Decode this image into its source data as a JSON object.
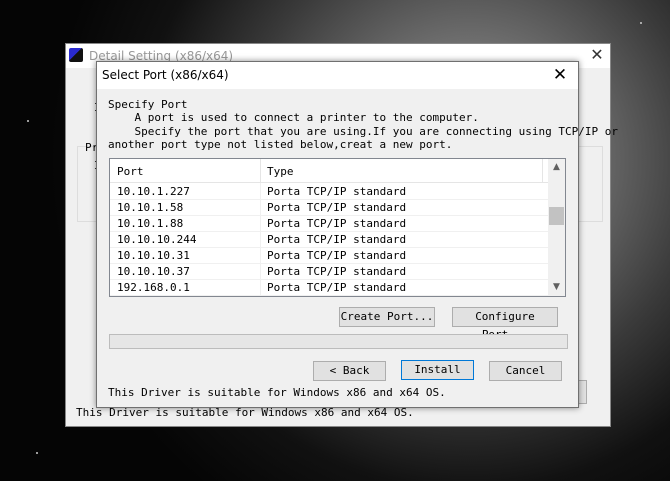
{
  "back_window": {
    "title": "Detail Setting (x86/x64)",
    "close_glyph": "✕",
    "footer_text": "This Driver is suitable for Windows x86 and x64 OS.",
    "frag_1": "I",
    "frag_2": "Pr",
    "frag_3": "I"
  },
  "dialog": {
    "title": "Select Port (x86/x64)",
    "close_glyph": "✕",
    "heading": "Specify Port",
    "desc_line1": "    A port is used to connect a printer to the computer.",
    "desc_line2": "    Specify the port that you are using.If you are connecting using TCP/IP or",
    "desc_line3": "another port type not listed below,creat a new port.",
    "list": {
      "headers": {
        "port": "Port",
        "type": "Type"
      },
      "rows": [
        {
          "port": "10.10.1.227",
          "type": "Porta TCP/IP standard"
        },
        {
          "port": "10.10.1.58",
          "type": "Porta TCP/IP standard"
        },
        {
          "port": "10.10.1.88",
          "type": "Porta TCP/IP standard"
        },
        {
          "port": "10.10.10.244",
          "type": "Porta TCP/IP standard"
        },
        {
          "port": "10.10.10.31",
          "type": "Porta TCP/IP standard"
        },
        {
          "port": "10.10.10.37",
          "type": "Porta TCP/IP standard"
        },
        {
          "port": "192.168.0.1",
          "type": "Porta TCP/IP standard"
        }
      ],
      "scroll_up_glyph": "▲",
      "scroll_down_glyph": "▼"
    },
    "buttons": {
      "create_port": "Create Port...",
      "configure_port": "Configure Port...",
      "back": "< Back",
      "install": "Install",
      "cancel": "Cancel"
    },
    "progress": 0,
    "footer_text": "This Driver is suitable for Windows x86 and x64 OS."
  }
}
